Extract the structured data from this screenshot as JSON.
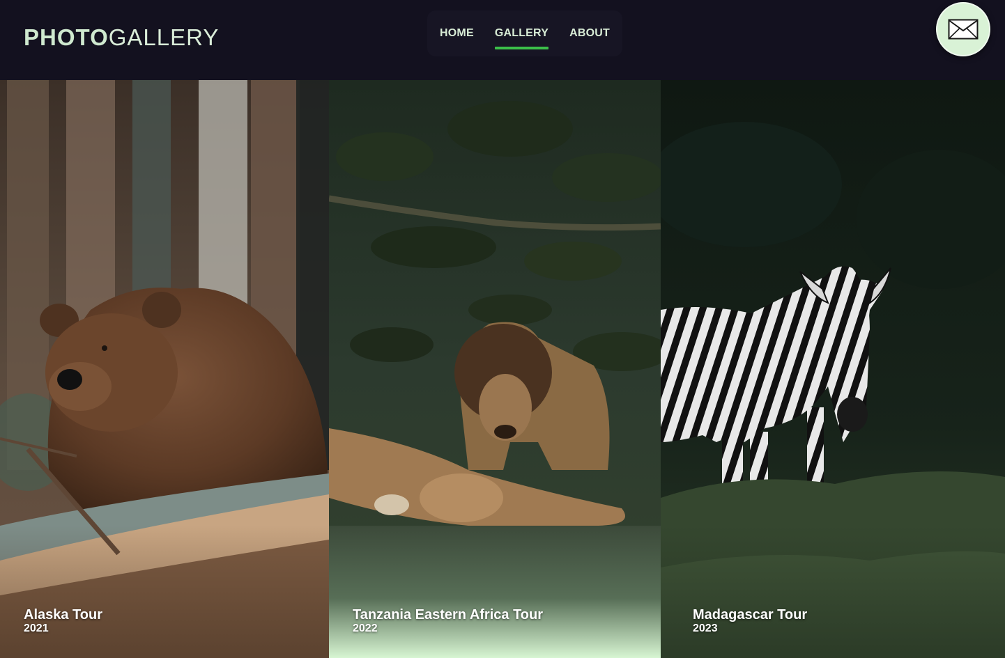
{
  "brand": {
    "bold": "PHOTO",
    "light": "GALLERY"
  },
  "nav": {
    "items": [
      {
        "label": "HOME"
      },
      {
        "label": "GALLERY",
        "active": true
      },
      {
        "label": "ABOUT"
      }
    ]
  },
  "contact": {
    "icon": "envelope-icon"
  },
  "gallery": {
    "cards": [
      {
        "title": "Alaska Tour",
        "year": "2021",
        "image": "bear-photo"
      },
      {
        "title": "Tanzania Eastern Africa Tour",
        "year": "2022",
        "image": "lion-photo"
      },
      {
        "title": "Madagascar Tour",
        "year": "2023",
        "image": "zebra-photo"
      }
    ]
  },
  "colors": {
    "background": "#13111f",
    "accent": "#3cbf4a",
    "text_light": "#d8ecd6",
    "mail_button": "#d9f2d6"
  }
}
